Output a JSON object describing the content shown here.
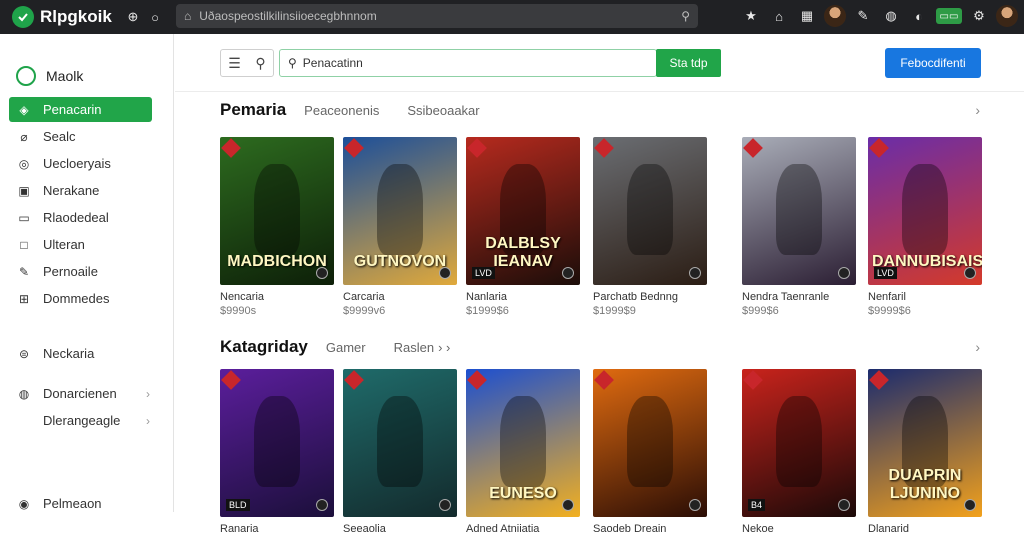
{
  "app": {
    "name": "Rlpgkoik"
  },
  "url": {
    "text": "Uðaospeostilkilinsiioecegbhnnom"
  },
  "sidebar": {
    "title": "Maolk",
    "items": [
      {
        "label": "Penacarin",
        "icon": "store-icon",
        "active": true
      },
      {
        "label": "Sealc",
        "icon": "link-icon"
      },
      {
        "label": "Uecloeryais",
        "icon": "controller-icon"
      },
      {
        "label": "Nerakane",
        "icon": "chart-icon"
      },
      {
        "label": "Rlaodedeal",
        "icon": "bookmark-icon"
      },
      {
        "label": "Ulteran",
        "icon": "square-icon"
      },
      {
        "label": "Pernoaile",
        "icon": "pencil-icon"
      },
      {
        "label": "Dommedes",
        "icon": "gift-icon"
      },
      {
        "label": "Neckaria",
        "icon": "gamepad-icon"
      },
      {
        "label": "Donarcienen",
        "icon": "globe-icon"
      },
      {
        "label": "Dlerangeagle",
        "icon": ""
      },
      {
        "label": "Pelmeaon",
        "icon": "user-icon"
      }
    ]
  },
  "search": {
    "placeholder": "Penacatinn",
    "button_label": "Sta tdp"
  },
  "primary_button": "Febocdifenti",
  "section1": {
    "title": "Pemaria",
    "tabs": [
      "Peaceonenis",
      "Ssibeoaakar"
    ],
    "cards": [
      {
        "title": "Nencaria",
        "price": "$9990s",
        "art": "MADBICHON",
        "colors": [
          "#2d6b1f",
          "#0d1f08"
        ],
        "badge": ""
      },
      {
        "title": "Carcaria",
        "price": "$9999v6",
        "art": "GUTNOVON",
        "colors": [
          "#1c4f9a",
          "#e0a93b"
        ],
        "badge": ""
      },
      {
        "title": "Nanlaria",
        "price": "$1999$6",
        "art": "DALBLSY IEANAV",
        "colors": [
          "#b62a1e",
          "#1b0d09"
        ],
        "badge": "LVD"
      },
      {
        "title": "Parchatb Bednng",
        "price": "$1999$9",
        "art": "",
        "colors": [
          "#6b6e73",
          "#2b1d14"
        ],
        "badge": ""
      },
      {
        "title": "Nendra Taenranle",
        "price": "$999$6",
        "art": "",
        "colors": [
          "#a9adb8",
          "#2b1e33"
        ],
        "badge": ""
      },
      {
        "title": "Nenfaril",
        "price": "$9999$6",
        "art": "DANNUBISAIS",
        "colors": [
          "#6a2da8",
          "#d43a2a"
        ],
        "badge": "LVD"
      }
    ]
  },
  "section2": {
    "title": "Katagriday",
    "tabs": [
      "Gamer",
      "Raslen"
    ],
    "cards": [
      {
        "title": "Ranaria",
        "price": "",
        "art": "",
        "colors": [
          "#5b1e9c",
          "#1b0f3a"
        ],
        "badge": "BLD"
      },
      {
        "title": "Seeaolia",
        "price": "",
        "art": "",
        "colors": [
          "#1f6b6a",
          "#132a2c"
        ],
        "badge": ""
      },
      {
        "title": "Adned Atniiatia",
        "price": "",
        "art": "EUNESO",
        "colors": [
          "#1c4fd0",
          "#f2b020"
        ],
        "badge": ""
      },
      {
        "title": "Saodeb Dreain",
        "price": "",
        "art": "",
        "colors": [
          "#e06b10",
          "#2a0d05"
        ],
        "badge": ""
      },
      {
        "title": "Nekoe",
        "price": "",
        "art": "",
        "colors": [
          "#c9231c",
          "#1a0908"
        ],
        "badge": "B4"
      },
      {
        "title": "Dlanarid",
        "price": "",
        "art": "DUAPRIN LJUNINO",
        "colors": [
          "#1b2b6e",
          "#f2a11c"
        ],
        "badge": ""
      }
    ]
  }
}
